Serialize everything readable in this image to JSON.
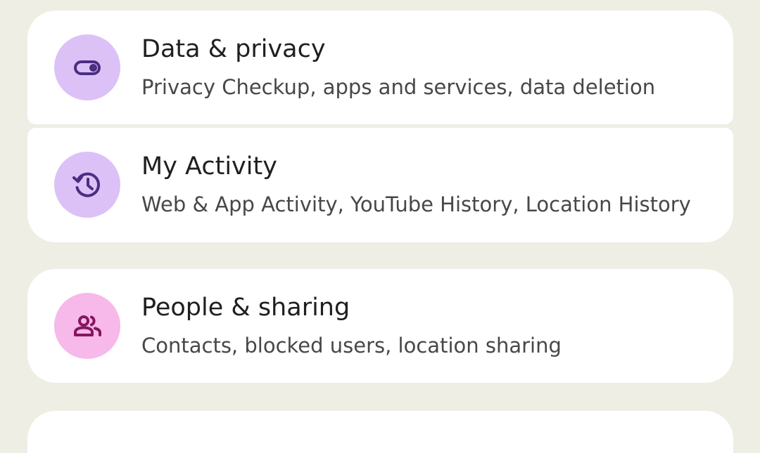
{
  "colors": {
    "background": "#eeeee4",
    "card": "#ffffff",
    "title_text": "#1f1f1f",
    "subtitle_text": "#474747",
    "purple_circle": "#dcc1f7",
    "purple_icon": "#4a2e82",
    "pink_circle": "#f7b8ea",
    "pink_icon": "#86155f"
  },
  "items": [
    {
      "title": "Data & privacy",
      "subtitle": "Privacy Checkup, apps and services, data deletion",
      "icon": "toggle-icon"
    },
    {
      "title": "My Activity",
      "subtitle": "Web & App Activity, YouTube History, Location History",
      "icon": "history-icon"
    },
    {
      "title": "People & sharing",
      "subtitle": "Contacts, blocked users, location sharing",
      "icon": "people-icon"
    }
  ]
}
